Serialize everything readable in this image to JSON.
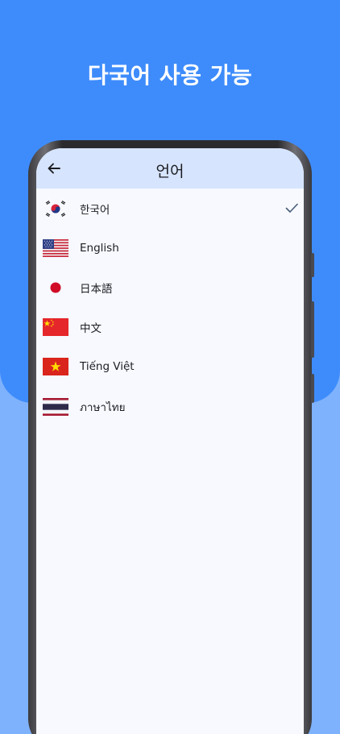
{
  "headline": "다국어 사용 가능",
  "appbar": {
    "title": "언어",
    "back_icon": "arrow-left-icon"
  },
  "languages": [
    {
      "label": "한국어",
      "flag": "korea-flag-icon",
      "selected": true
    },
    {
      "label": "English",
      "flag": "usa-flag-icon",
      "selected": false
    },
    {
      "label": "日本語",
      "flag": "japan-flag-icon",
      "selected": false
    },
    {
      "label": "中文",
      "flag": "china-flag-icon",
      "selected": false
    },
    {
      "label": "Tiếng Việt",
      "flag": "vietnam-flag-icon",
      "selected": false
    },
    {
      "label": "ภาษาไทย",
      "flag": "thailand-flag-icon",
      "selected": false
    }
  ],
  "selected_icon": "checkmark-icon",
  "colors": {
    "background_top": "#3e8cfc",
    "background_bottom": "#7fb2fc",
    "appbar": "#d6e4fe",
    "screen": "#f7f9ff",
    "check": "#4a5f7a"
  }
}
